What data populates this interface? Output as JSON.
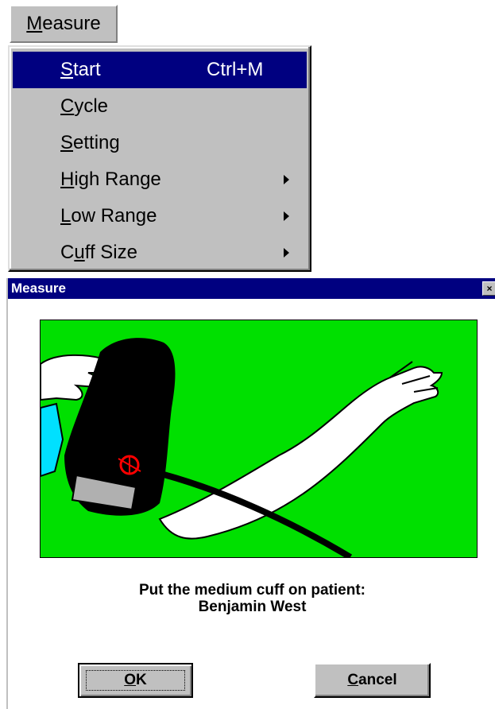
{
  "menubar": {
    "menu_title": "Measure"
  },
  "menu": {
    "items": [
      {
        "label": "Start",
        "mnemonic_first": "S",
        "rest": "tart",
        "shortcut": "Ctrl+M",
        "selected": true,
        "submenu": false
      },
      {
        "label": "Cycle",
        "mnemonic_first": "C",
        "rest": "ycle",
        "shortcut": "",
        "selected": false,
        "submenu": false
      },
      {
        "label": "Setting",
        "mnemonic_first": "S",
        "rest": "etting",
        "shortcut": "",
        "selected": false,
        "submenu": false
      },
      {
        "label": "High Range",
        "mnemonic_first": "H",
        "rest": "igh Range",
        "shortcut": "",
        "selected": false,
        "submenu": true
      },
      {
        "label": "Low Range",
        "mnemonic_first": "L",
        "rest": "ow Range",
        "shortcut": "",
        "selected": false,
        "submenu": true
      },
      {
        "label": "Cuff Size",
        "mnemonic_prefix": "C",
        "mnemonic_first": "u",
        "rest": "ff Size",
        "shortcut": "",
        "selected": false,
        "submenu": true
      }
    ]
  },
  "dialog": {
    "title": "Measure",
    "close_glyph": "×",
    "message_line1": "Put the medium cuff on patient:",
    "message_line2": "Benjamin West",
    "ok_mnemonic": "O",
    "ok_rest": "K",
    "cancel_mnemonic": "C",
    "cancel_rest": "ancel"
  },
  "colors": {
    "window_face": "#c0c0c0",
    "selection": "#000080",
    "illustration_bg": "#00e000",
    "cuff": "#000000",
    "gauge_mark": "#ff0000"
  },
  "icons": {
    "close": "close-icon",
    "submenu": "submenu-arrow-icon"
  }
}
